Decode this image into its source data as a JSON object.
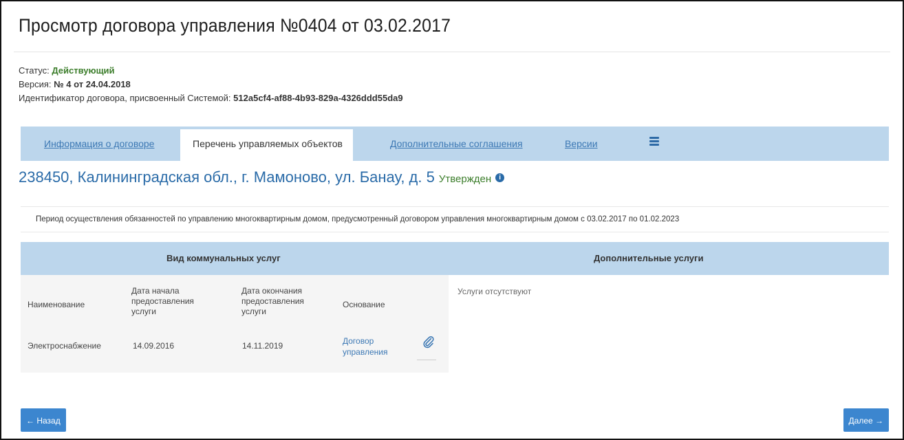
{
  "header": {
    "title": "Просмотр договора управления №0404 от 03.02.2017"
  },
  "meta": {
    "status_label": "Статус:",
    "status_value": "Действующий",
    "version_label": "Версия:",
    "version_value": "№ 4 от 24.04.2018",
    "id_label": "Идентификатор договора, присвоенный Системой:",
    "id_value": "512a5cf4-af88-4b93-829a-4326ddd55da9"
  },
  "tabs": [
    {
      "label": "Информация о договоре",
      "active": false
    },
    {
      "label": "Перечень управляемых объектов",
      "active": true
    },
    {
      "label": "Дополнительные соглашения",
      "active": false
    },
    {
      "label": "Версии",
      "active": false
    }
  ],
  "object": {
    "address": "238450, Калининградская обл., г. Мамоново, ул. Банау, д. 5",
    "status": "Утвержден",
    "info_icon": "i"
  },
  "period_text": "Период осуществления обязанностей по управлению многоквартирным домом, предусмотренный договором управления многоквартирным домом с 03.02.2017 по 01.02.2023",
  "utilities": {
    "section_title": "Вид коммунальных услуг",
    "columns": [
      "Наименование",
      "Дата начала предоставления услуги",
      "Дата окончания предоставления услуги",
      "Основание"
    ],
    "rows": [
      {
        "name": "Электроснабжение",
        "start": "14.09.2016",
        "end": "14.11.2019",
        "basis_line1": "Договор",
        "basis_line2": "управления"
      }
    ]
  },
  "additional": {
    "section_title": "Дополнительные услуги",
    "empty_text": "Услуги отсутствуют"
  },
  "buttons": {
    "back": "← Назад",
    "next": "Далее →"
  },
  "colors": {
    "accent": "#3c86cf",
    "tab_bar": "#bcd6ec",
    "status_green": "#3b7d2a",
    "link_blue": "#3c78b4"
  }
}
